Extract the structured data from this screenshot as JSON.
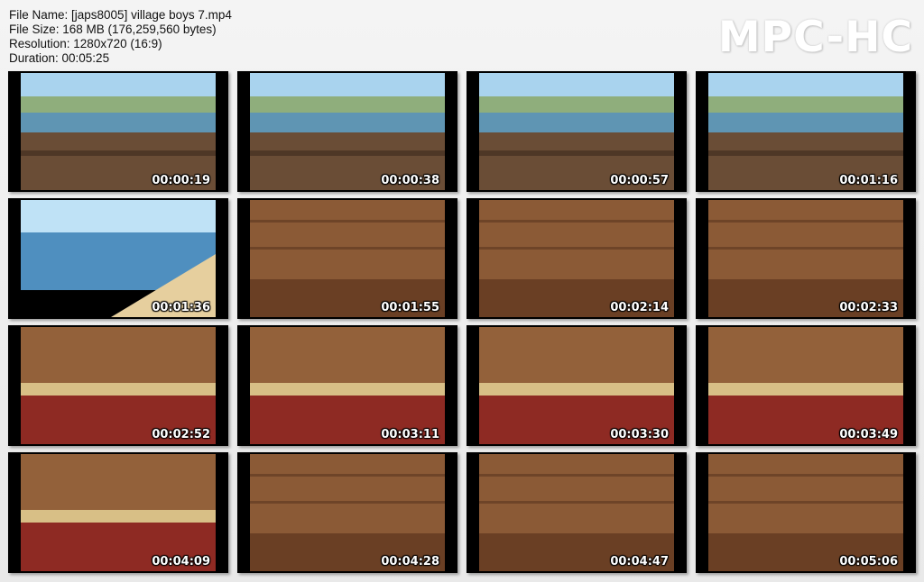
{
  "info": {
    "file_name": "File Name: [japs8005] village boys 7.mp4",
    "file_size": "File Size: 168 MB (176,259,560 bytes)",
    "resolution": "Resolution: 1280x720 (16:9)",
    "duration": "Duration: 00:05:25"
  },
  "logo": "MPC-HC",
  "thumbnails": [
    {
      "time": "00:00:19",
      "scene": "outdoor-dock"
    },
    {
      "time": "00:00:38",
      "scene": "outdoor-dock"
    },
    {
      "time": "00:00:57",
      "scene": "outdoor-dock"
    },
    {
      "time": "00:01:16",
      "scene": "outdoor-dock"
    },
    {
      "time": "00:01:36",
      "scene": "beach"
    },
    {
      "time": "00:01:55",
      "scene": "indoor-room"
    },
    {
      "time": "00:02:14",
      "scene": "indoor-room"
    },
    {
      "time": "00:02:33",
      "scene": "indoor-room"
    },
    {
      "time": "00:02:52",
      "scene": "indoor-bed"
    },
    {
      "time": "00:03:11",
      "scene": "indoor-bed"
    },
    {
      "time": "00:03:30",
      "scene": "indoor-bed"
    },
    {
      "time": "00:03:49",
      "scene": "indoor-bed"
    },
    {
      "time": "00:04:09",
      "scene": "indoor-bed"
    },
    {
      "time": "00:04:28",
      "scene": "indoor-room"
    },
    {
      "time": "00:04:47",
      "scene": "indoor-room"
    },
    {
      "time": "00:05:06",
      "scene": "indoor-room"
    }
  ]
}
